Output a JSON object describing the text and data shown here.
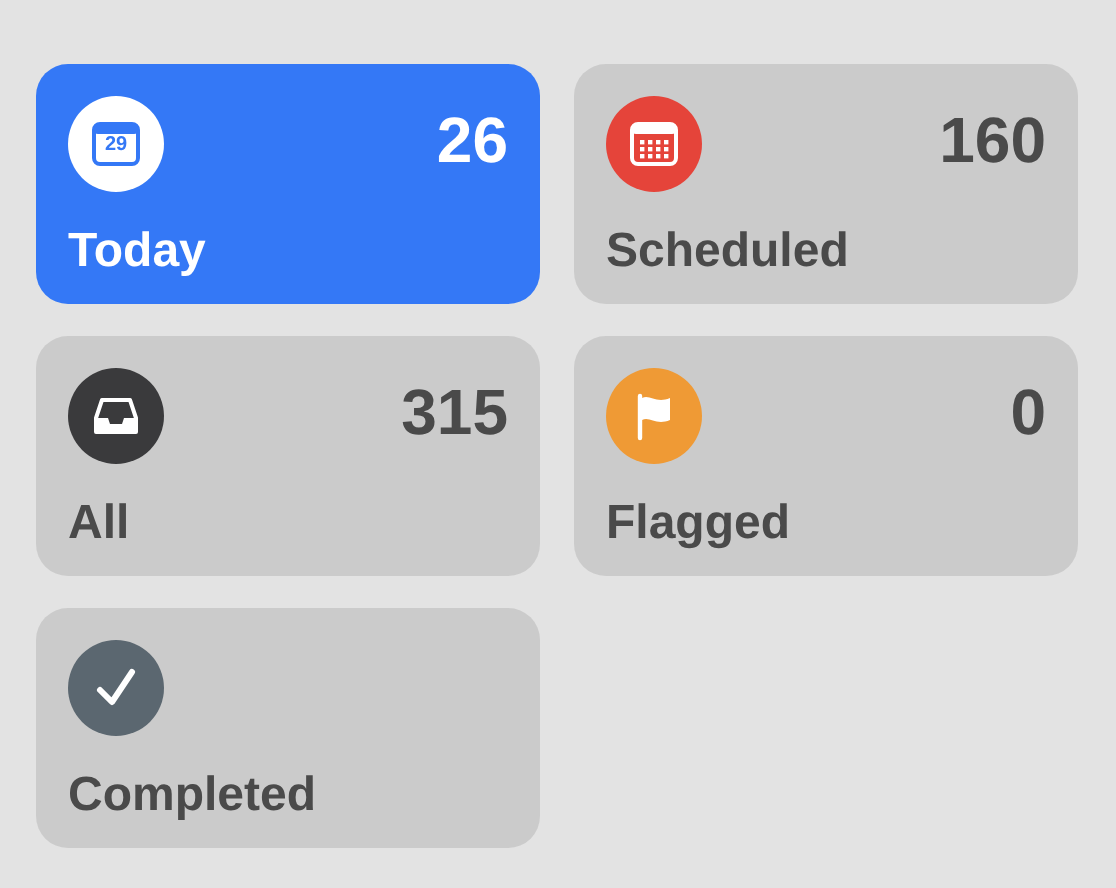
{
  "smart_lists": [
    {
      "kind": "today",
      "label": "Today",
      "count": "26",
      "selected": true,
      "color": "#3478f6",
      "icon_text": "29"
    },
    {
      "kind": "scheduled",
      "label": "Scheduled",
      "count": "160",
      "selected": false,
      "color": "#e5443a"
    },
    {
      "kind": "all",
      "label": "All",
      "count": "315",
      "selected": false,
      "color": "#3a3a3c"
    },
    {
      "kind": "flagged",
      "label": "Flagged",
      "count": "0",
      "selected": false,
      "color": "#ef9a35"
    },
    {
      "kind": "completed",
      "label": "Completed",
      "selected": false,
      "color": "#5b6770"
    }
  ]
}
